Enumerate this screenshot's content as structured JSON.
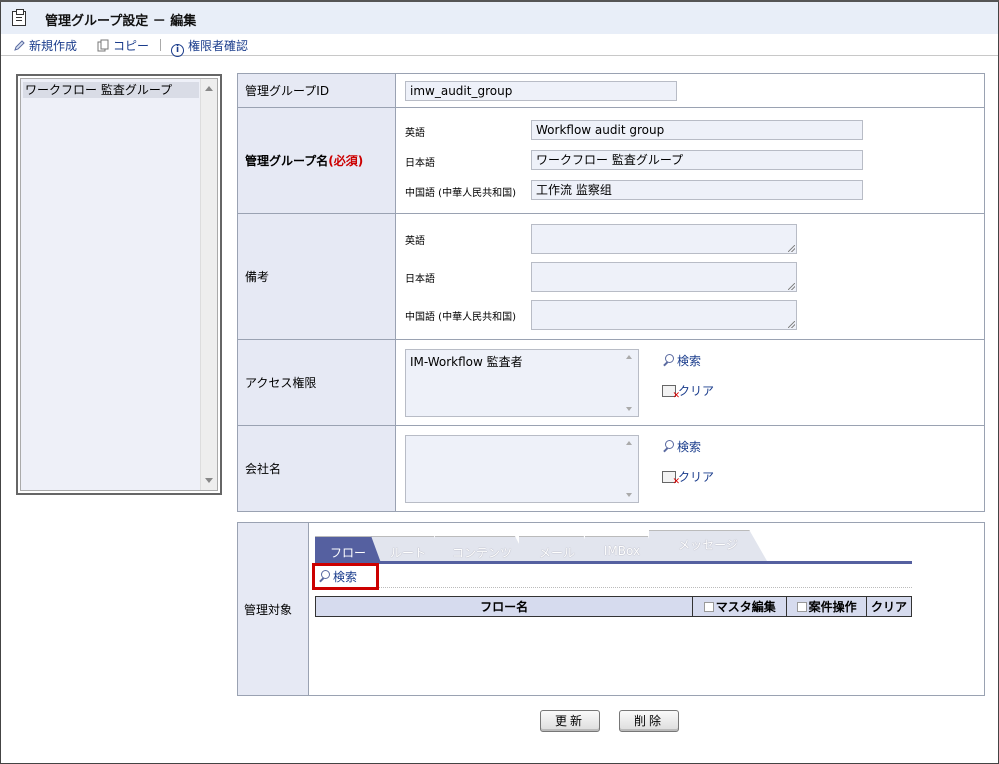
{
  "header": {
    "title": "管理グループ設定 － 編集"
  },
  "toolbar": {
    "new_label": "新規作成",
    "copy_label": "コピー",
    "auth_label": "権限者確認"
  },
  "left_list": {
    "items": [
      "ワークフロー 監査グループ"
    ]
  },
  "form": {
    "group_id_label": "管理グループID",
    "group_id_value": "imw_audit_group",
    "group_name_label": "管理グループ名",
    "required_label": "(必須)",
    "lang_en": "英語",
    "lang_ja": "日本語",
    "lang_zh": "中国語 (中華人民共和国)",
    "name_en": "Workflow audit group",
    "name_ja": "ワークフロー 監査グループ",
    "name_zh": "工作流 监察组",
    "remarks_label": "備考",
    "access_label": "アクセス権限",
    "access_value": "IM-Workflow 監査者",
    "company_label": "会社名",
    "search_label": "検索",
    "clear_label": "クリア"
  },
  "target": {
    "label": "管理対象",
    "tabs": [
      "フロー",
      "ルート",
      "コンテンツ",
      "メール",
      "IMBox",
      "メッセージ"
    ],
    "search_label": "検索",
    "columns": {
      "flow_name": "フロー名",
      "master_edit": "マスタ編集",
      "case_op": "案件操作",
      "clear": "クリア"
    }
  },
  "buttons": {
    "update": "更新",
    "delete": "削除"
  },
  "colors": {
    "tab_active": "#5560a0",
    "highlight": "#cc0000",
    "link": "#1a3c8c"
  }
}
